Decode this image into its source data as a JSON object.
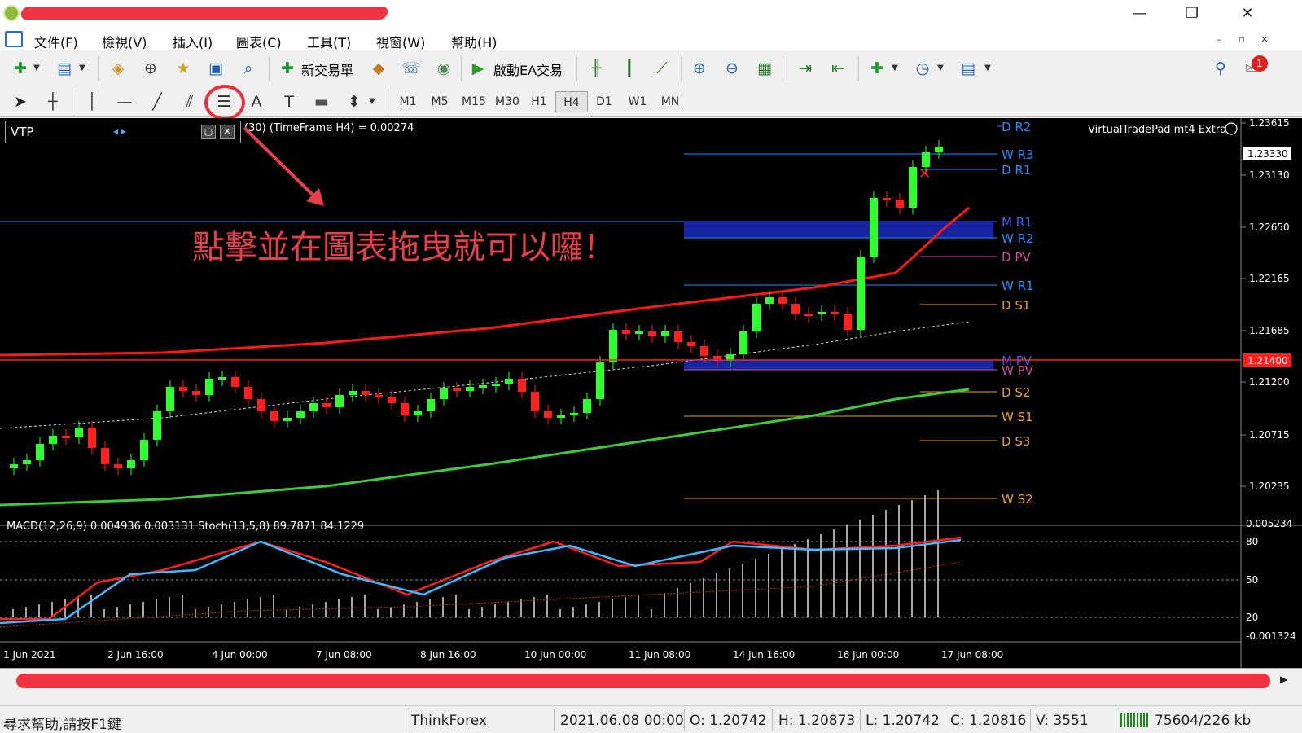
{
  "menu": [
    "文件(F)",
    "檢視(V)",
    "插入(I)",
    "圖表(C)",
    "工具(T)",
    "視窗(W)",
    "幫助(H)"
  ],
  "toolbar": {
    "new_trade_label": "新交易單",
    "ea_trade_label": "啟動EA交易",
    "timeframes": [
      "M1",
      "M5",
      "M15",
      "M30",
      "H1",
      "H4",
      "D1",
      "W1",
      "MN"
    ],
    "active_timeframe": "H4"
  },
  "panel": {
    "title": "VTP",
    "arrows": "◂ ▸"
  },
  "chart": {
    "info_text": "(30) (TimeFrame H4) = 0.00274",
    "ea_label": "VirtualTradePad mt4 Extra",
    "annotation": "點擊並在圖表拖曳就可以囉！",
    "current_price": "1.23330",
    "hline_price": "1.21400",
    "price_axis": [
      "1.23615",
      "1.23130",
      "1.22650",
      "1.22165",
      "1.21685",
      "1.21200",
      "1.20715",
      "1.20235"
    ],
    "levels": [
      "D R2",
      "W R3",
      "D R1",
      "M R1",
      "W R2",
      "D PV",
      "W R1",
      "D S1",
      "M PV",
      "W PV",
      "D S2",
      "W S1",
      "D S3",
      "W S2"
    ],
    "level_colors": {
      "weekly": "#1e90ff",
      "daily_top": "#1e90ff",
      "daily_pv": "#d050a0",
      "support": "#e8a030",
      "monthly": "#4060ff"
    },
    "sub_info": "MACD(12,26,9) 0.004936 0.003131  Stoch(13,5,8) 89.7871 84.1229",
    "sub_axis": [
      "0.005234",
      "80",
      "50",
      "20",
      "-0.001324"
    ],
    "time_axis": [
      "1 Jun 2021",
      "2 Jun 16:00",
      "4 Jun 00:00",
      "7 Jun 08:00",
      "8 Jun 16:00",
      "10 Jun 00:00",
      "11 Jun 08:00",
      "14 Jun 16:00",
      "16 Jun 00:00",
      "17 Jun 08:00"
    ]
  },
  "status": {
    "help": "尋求幫助,請按F1鍵",
    "broker": "ThinkForex",
    "datetime": "2021.06.08 00:00",
    "open": "O: 1.20742",
    "high": "H: 1.20873",
    "low": "L: 1.20742",
    "close": "C: 1.20816",
    "volume": "V: 3551",
    "traffic": "75604/226 kb"
  }
}
